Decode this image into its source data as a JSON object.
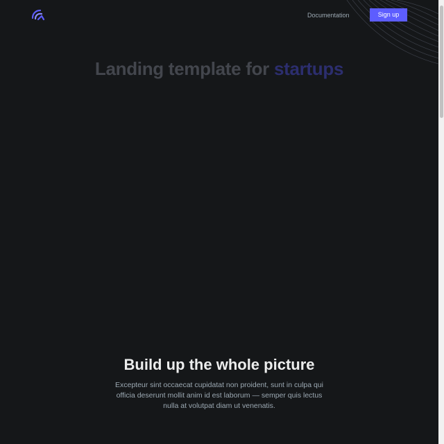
{
  "header": {
    "logo_icon": "logo-icon",
    "nav": {
      "documentation_label": "Documentation",
      "signup_label": "Sign up"
    }
  },
  "hero": {
    "title_main": "Landing template for",
    "title_accent": "startups"
  },
  "section": {
    "title": "Build up the whole picture",
    "text": "Excepteur sint occaecat cupidatat non proident, sunt in culpa qui officia deserunt mollit anim id est laborum — semper quis lectus nulla at volutpat diam ut venenatis."
  },
  "colors": {
    "background": "#151719",
    "accent": "#5d5dff",
    "body_text": "#9ca9b3",
    "heading": "#eceded"
  }
}
